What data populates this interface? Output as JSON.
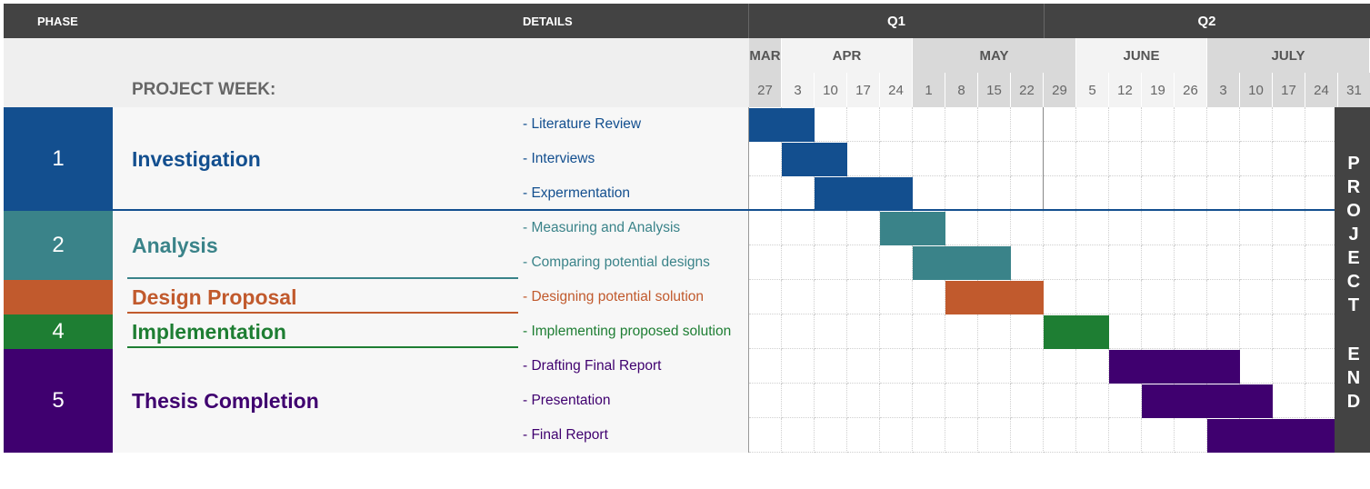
{
  "header": {
    "phase_label": "PHASE",
    "details_label": "DETAILS",
    "project_week_label": "PROJECT WEEK:"
  },
  "quarters": [
    {
      "label": "Q1",
      "start": 0,
      "span": 9
    },
    {
      "label": "Q2",
      "start": 9,
      "span": 10
    }
  ],
  "months": [
    {
      "label": "MAR",
      "start": 0,
      "span": 1
    },
    {
      "label": "APR",
      "start": 1,
      "span": 4
    },
    {
      "label": "MAY",
      "start": 5,
      "span": 5
    },
    {
      "label": "JUNE",
      "start": 10,
      "span": 4
    },
    {
      "label": "JULY",
      "start": 14,
      "span": 5
    }
  ],
  "weeks": [
    "27",
    "3",
    "10",
    "17",
    "24",
    "1",
    "8",
    "15",
    "22",
    "29",
    "5",
    "12",
    "19",
    "26",
    "3",
    "10",
    "17",
    "24",
    "31"
  ],
  "phases": [
    {
      "number": "1",
      "name": "Investigation",
      "color": "#134F8F",
      "rows": [
        0,
        2
      ]
    },
    {
      "number": "2",
      "name": "Analysis",
      "color": "#3A8389",
      "rows": [
        3,
        4
      ]
    },
    {
      "number": "",
      "name": "Design Proposal",
      "color": "#C15A2D",
      "rows": [
        5,
        5
      ]
    },
    {
      "number": "4",
      "name": "Implementation",
      "color": "#1E7E33",
      "rows": [
        6,
        6
      ]
    },
    {
      "number": "5",
      "name": "Thesis Completion",
      "color": "#3F006F",
      "rows": [
        7,
        9
      ]
    }
  ],
  "chart_data": {
    "type": "gantt",
    "tasks": [
      {
        "detail": "- Literature Review",
        "phase": 0,
        "start_week": "MAR 27",
        "end_week": "APR 3"
      },
      {
        "detail": "- Interviews",
        "phase": 0,
        "start_week": "APR 3",
        "end_week": "APR 10"
      },
      {
        "detail": "- Expermentation",
        "phase": 0,
        "start_week": "APR 10",
        "end_week": "APR 24"
      },
      {
        "detail": "- Measuring and Analysis",
        "phase": 1,
        "start_week": "APR 24",
        "end_week": "MAY 1"
      },
      {
        "detail": "- Comparing potential designs",
        "phase": 1,
        "start_week": "MAY 1",
        "end_week": "MAY 15"
      },
      {
        "detail": "- Designing potential solution",
        "phase": 2,
        "start_week": "MAY 8",
        "end_week": "MAY 22"
      },
      {
        "detail": "- Implementing proposed solution",
        "phase": 3,
        "start_week": "MAY 29",
        "end_week": "JUNE 5"
      },
      {
        "detail": "- Drafting Final Report",
        "phase": 4,
        "start_week": "JUNE 12",
        "end_week": "JULY 3"
      },
      {
        "detail": "- Presentation",
        "phase": 4,
        "start_week": "JUNE 19",
        "end_week": "JULY 10"
      },
      {
        "detail": "- Final Report",
        "phase": 4,
        "start_week": "JULY 3",
        "end_week": "JULY 24"
      }
    ]
  },
  "project_end": {
    "text": "PROJECT END",
    "color": "#434343"
  }
}
